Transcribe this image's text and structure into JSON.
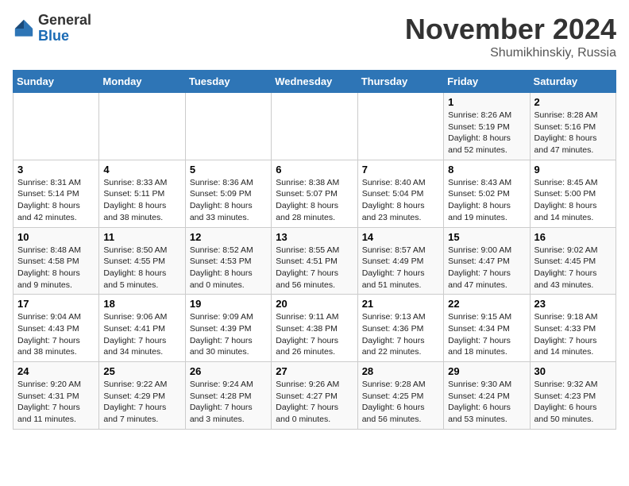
{
  "header": {
    "logo_general": "General",
    "logo_blue": "Blue",
    "month_title": "November 2024",
    "location": "Shumikhinskiy, Russia"
  },
  "weekdays": [
    "Sunday",
    "Monday",
    "Tuesday",
    "Wednesday",
    "Thursday",
    "Friday",
    "Saturday"
  ],
  "weeks": [
    [
      {
        "day": "",
        "info": ""
      },
      {
        "day": "",
        "info": ""
      },
      {
        "day": "",
        "info": ""
      },
      {
        "day": "",
        "info": ""
      },
      {
        "day": "",
        "info": ""
      },
      {
        "day": "1",
        "info": "Sunrise: 8:26 AM\nSunset: 5:19 PM\nDaylight: 8 hours and 52 minutes."
      },
      {
        "day": "2",
        "info": "Sunrise: 8:28 AM\nSunset: 5:16 PM\nDaylight: 8 hours and 47 minutes."
      }
    ],
    [
      {
        "day": "3",
        "info": "Sunrise: 8:31 AM\nSunset: 5:14 PM\nDaylight: 8 hours and 42 minutes."
      },
      {
        "day": "4",
        "info": "Sunrise: 8:33 AM\nSunset: 5:11 PM\nDaylight: 8 hours and 38 minutes."
      },
      {
        "day": "5",
        "info": "Sunrise: 8:36 AM\nSunset: 5:09 PM\nDaylight: 8 hours and 33 minutes."
      },
      {
        "day": "6",
        "info": "Sunrise: 8:38 AM\nSunset: 5:07 PM\nDaylight: 8 hours and 28 minutes."
      },
      {
        "day": "7",
        "info": "Sunrise: 8:40 AM\nSunset: 5:04 PM\nDaylight: 8 hours and 23 minutes."
      },
      {
        "day": "8",
        "info": "Sunrise: 8:43 AM\nSunset: 5:02 PM\nDaylight: 8 hours and 19 minutes."
      },
      {
        "day": "9",
        "info": "Sunrise: 8:45 AM\nSunset: 5:00 PM\nDaylight: 8 hours and 14 minutes."
      }
    ],
    [
      {
        "day": "10",
        "info": "Sunrise: 8:48 AM\nSunset: 4:58 PM\nDaylight: 8 hours and 9 minutes."
      },
      {
        "day": "11",
        "info": "Sunrise: 8:50 AM\nSunset: 4:55 PM\nDaylight: 8 hours and 5 minutes."
      },
      {
        "day": "12",
        "info": "Sunrise: 8:52 AM\nSunset: 4:53 PM\nDaylight: 8 hours and 0 minutes."
      },
      {
        "day": "13",
        "info": "Sunrise: 8:55 AM\nSunset: 4:51 PM\nDaylight: 7 hours and 56 minutes."
      },
      {
        "day": "14",
        "info": "Sunrise: 8:57 AM\nSunset: 4:49 PM\nDaylight: 7 hours and 51 minutes."
      },
      {
        "day": "15",
        "info": "Sunrise: 9:00 AM\nSunset: 4:47 PM\nDaylight: 7 hours and 47 minutes."
      },
      {
        "day": "16",
        "info": "Sunrise: 9:02 AM\nSunset: 4:45 PM\nDaylight: 7 hours and 43 minutes."
      }
    ],
    [
      {
        "day": "17",
        "info": "Sunrise: 9:04 AM\nSunset: 4:43 PM\nDaylight: 7 hours and 38 minutes."
      },
      {
        "day": "18",
        "info": "Sunrise: 9:06 AM\nSunset: 4:41 PM\nDaylight: 7 hours and 34 minutes."
      },
      {
        "day": "19",
        "info": "Sunrise: 9:09 AM\nSunset: 4:39 PM\nDaylight: 7 hours and 30 minutes."
      },
      {
        "day": "20",
        "info": "Sunrise: 9:11 AM\nSunset: 4:38 PM\nDaylight: 7 hours and 26 minutes."
      },
      {
        "day": "21",
        "info": "Sunrise: 9:13 AM\nSunset: 4:36 PM\nDaylight: 7 hours and 22 minutes."
      },
      {
        "day": "22",
        "info": "Sunrise: 9:15 AM\nSunset: 4:34 PM\nDaylight: 7 hours and 18 minutes."
      },
      {
        "day": "23",
        "info": "Sunrise: 9:18 AM\nSunset: 4:33 PM\nDaylight: 7 hours and 14 minutes."
      }
    ],
    [
      {
        "day": "24",
        "info": "Sunrise: 9:20 AM\nSunset: 4:31 PM\nDaylight: 7 hours and 11 minutes."
      },
      {
        "day": "25",
        "info": "Sunrise: 9:22 AM\nSunset: 4:29 PM\nDaylight: 7 hours and 7 minutes."
      },
      {
        "day": "26",
        "info": "Sunrise: 9:24 AM\nSunset: 4:28 PM\nDaylight: 7 hours and 3 minutes."
      },
      {
        "day": "27",
        "info": "Sunrise: 9:26 AM\nSunset: 4:27 PM\nDaylight: 7 hours and 0 minutes."
      },
      {
        "day": "28",
        "info": "Sunrise: 9:28 AM\nSunset: 4:25 PM\nDaylight: 6 hours and 56 minutes."
      },
      {
        "day": "29",
        "info": "Sunrise: 9:30 AM\nSunset: 4:24 PM\nDaylight: 6 hours and 53 minutes."
      },
      {
        "day": "30",
        "info": "Sunrise: 9:32 AM\nSunset: 4:23 PM\nDaylight: 6 hours and 50 minutes."
      }
    ]
  ]
}
